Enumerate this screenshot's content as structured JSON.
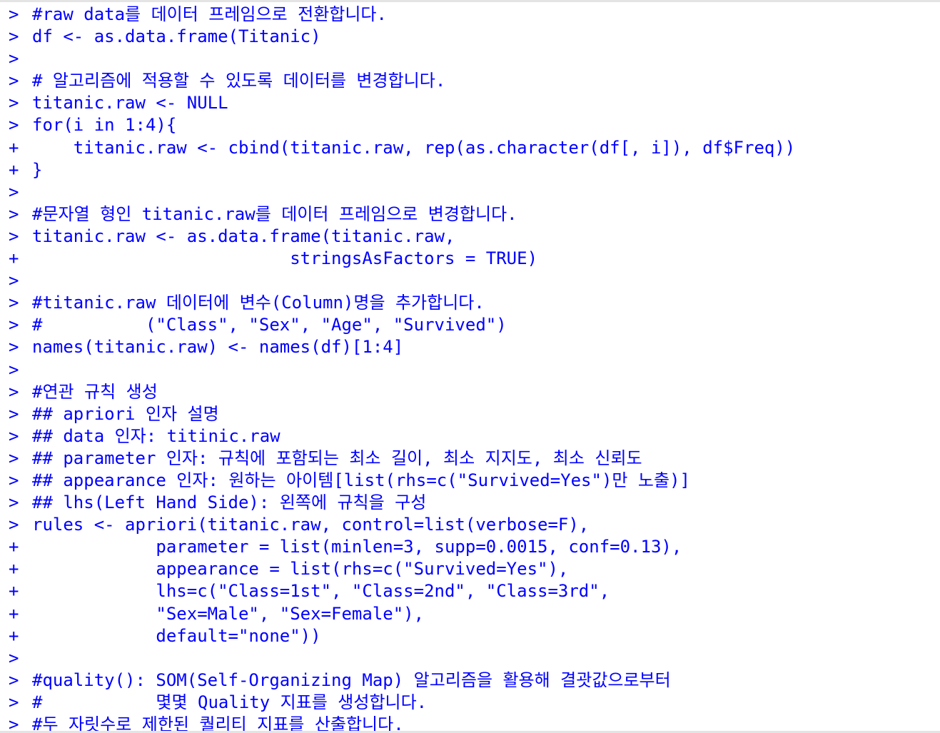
{
  "console": {
    "lines": [
      {
        "prompt": ">",
        "text": "#raw data를 데이터 프레임으로 전환합니다."
      },
      {
        "prompt": ">",
        "text": "df <- as.data.frame(Titanic)"
      },
      {
        "prompt": ">",
        "text": ""
      },
      {
        "prompt": ">",
        "text": "# 알고리즘에 적용할 수 있도록 데이터를 변경합니다."
      },
      {
        "prompt": ">",
        "text": "titanic.raw <- NULL"
      },
      {
        "prompt": ">",
        "text": "for(i in 1:4){"
      },
      {
        "prompt": "+",
        "text": "    titanic.raw <- cbind(titanic.raw, rep(as.character(df[, i]), df$Freq))"
      },
      {
        "prompt": "+",
        "text": "}"
      },
      {
        "prompt": ">",
        "text": ""
      },
      {
        "prompt": ">",
        "text": "#문자열 형인 titanic.raw를 데이터 프레임으로 변경합니다."
      },
      {
        "prompt": ">",
        "text": "titanic.raw <- as.data.frame(titanic.raw,"
      },
      {
        "prompt": "+",
        "text": "                         stringsAsFactors = TRUE)"
      },
      {
        "prompt": ">",
        "text": ""
      },
      {
        "prompt": ">",
        "text": "#titanic.raw 데이터에 변수(Column)명을 추가합니다."
      },
      {
        "prompt": ">",
        "text": "#          (\"Class\", \"Sex\", \"Age\", \"Survived\")"
      },
      {
        "prompt": ">",
        "text": "names(titanic.raw) <- names(df)[1:4]"
      },
      {
        "prompt": ">",
        "text": ""
      },
      {
        "prompt": ">",
        "text": "#연관 규칙 생성"
      },
      {
        "prompt": ">",
        "text": "## apriori 인자 설명"
      },
      {
        "prompt": ">",
        "text": "## data 인자: titinic.raw"
      },
      {
        "prompt": ">",
        "text": "## parameter 인자: 규칙에 포함되는 최소 길이, 최소 지지도, 최소 신뢰도"
      },
      {
        "prompt": ">",
        "text": "## appearance 인자: 원하는 아이템[list(rhs=c(\"Survived=Yes\")만 노출)]"
      },
      {
        "prompt": ">",
        "text": "## lhs(Left Hand Side): 왼쪽에 규칙을 구성"
      },
      {
        "prompt": ">",
        "text": "rules <- apriori(titanic.raw, control=list(verbose=F),"
      },
      {
        "prompt": "+",
        "text": "            parameter = list(minlen=3, supp=0.0015, conf=0.13),"
      },
      {
        "prompt": "+",
        "text": "            appearance = list(rhs=c(\"Survived=Yes\"),"
      },
      {
        "prompt": "+",
        "text": "            lhs=c(\"Class=1st\", \"Class=2nd\", \"Class=3rd\","
      },
      {
        "prompt": "+",
        "text": "            \"Sex=Male\", \"Sex=Female\"),"
      },
      {
        "prompt": "+",
        "text": "            default=\"none\"))"
      },
      {
        "prompt": ">",
        "text": ""
      },
      {
        "prompt": ">",
        "text": "#quality(): SOM(Self-Organizing Map) 알고리즘을 활용해 결괏값으로부터"
      },
      {
        "prompt": ">",
        "text": "#           몇몇 Quality 지표를 생성합니다."
      },
      {
        "prompt": ">",
        "text": "#두 자릿수로 제한된 퀄리티 지표를 산출합니다."
      }
    ]
  }
}
